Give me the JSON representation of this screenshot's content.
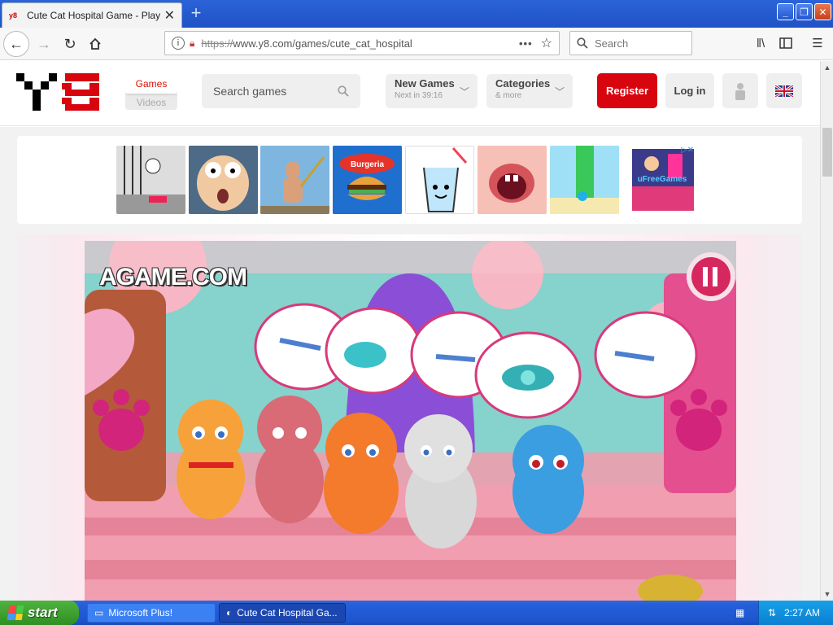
{
  "browser": {
    "tab_title": "Cute Cat Hospital Game - Play onl",
    "favicon": "y8",
    "new_tab_symbol": "+",
    "url_protocol": "https://",
    "url_rest": "www.y8.com/games/cute_cat_hospital",
    "search_placeholder": "Search",
    "page_actions": "•••"
  },
  "site": {
    "nav_games": "Games",
    "nav_videos": "Videos",
    "search_placeholder": "Search games",
    "new_games_label": "New Games",
    "new_games_sub": "Next in 39:16",
    "categories_label": "Categories",
    "categories_sub": "& more",
    "register_label": "Register",
    "login_label": "Log in",
    "accent": "#d8050f"
  },
  "ads": {
    "thumbs": [
      {
        "caption": ""
      },
      {
        "caption": ""
      },
      {
        "caption": ""
      },
      {
        "caption": "Burgeria"
      },
      {
        "caption": ""
      },
      {
        "caption": ""
      },
      {
        "caption": ""
      },
      {
        "caption": "uFreeGames"
      }
    ]
  },
  "game": {
    "brand": "AGAME.COM"
  },
  "taskbar": {
    "start_label": "start",
    "items": [
      {
        "label": "Microsoft Plus!"
      },
      {
        "label": "Cute Cat Hospital Ga..."
      }
    ],
    "clock": "2:27 AM"
  }
}
